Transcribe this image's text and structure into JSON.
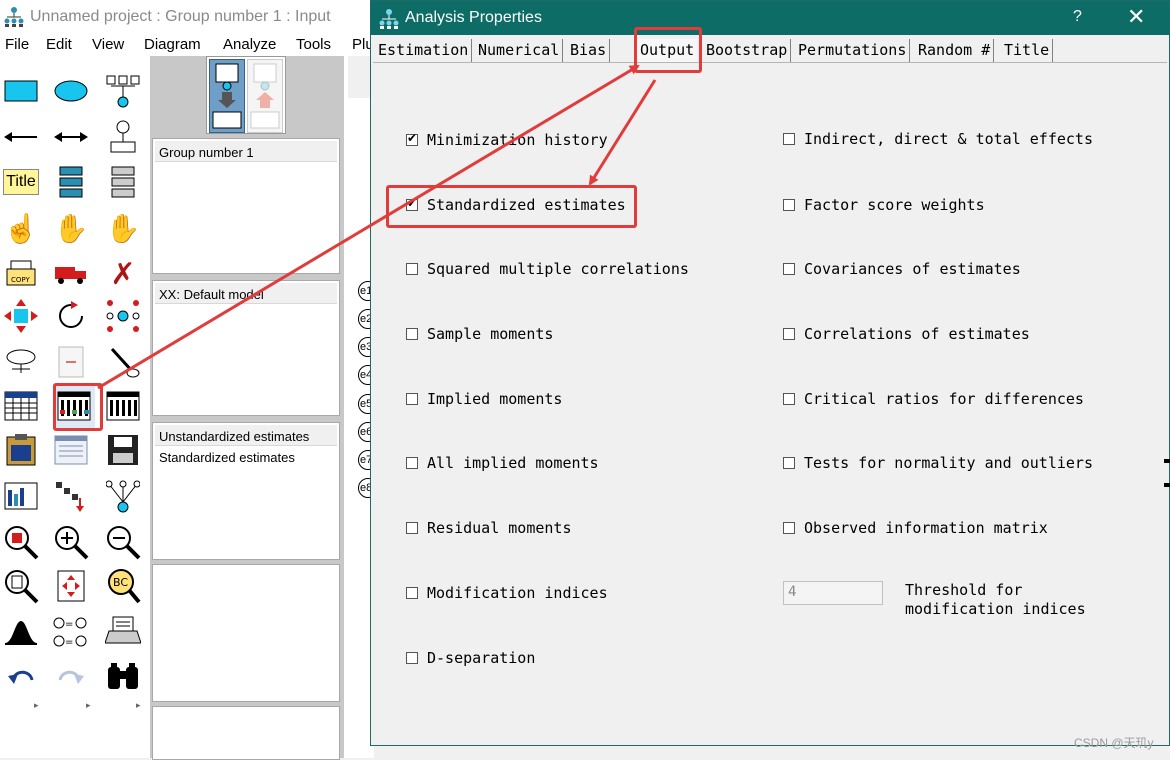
{
  "main_window": {
    "title": "Unnamed project : Group number 1 : Input"
  },
  "menu": [
    "File",
    "Edit",
    "View",
    "Diagram",
    "Analyze",
    "Tools",
    "Plu"
  ],
  "panels": {
    "groups": [
      "Group number 1"
    ],
    "models": [
      "XX: Default model"
    ],
    "estimates": [
      "Unstandardized estimates",
      "Standardized estimates"
    ]
  },
  "path_labels": [
    "e1",
    "e2",
    "e3",
    "e4",
    "e5",
    "e6",
    "e7",
    "e8"
  ],
  "toolbox": {
    "title_tool_label": "Title"
  },
  "dialog": {
    "title": "Analysis Properties",
    "help": "?",
    "close": "✕",
    "tabs": [
      "Estimation",
      "Numerical",
      "Bias",
      "Output",
      "Bootstrap",
      "Permutations",
      "Random #",
      "Title"
    ],
    "active_tab": "Output",
    "options_left": [
      {
        "label": "Minimization history",
        "checked": true
      },
      {
        "label": "Standardized estimates",
        "checked": true
      },
      {
        "label": "Squared multiple correlations",
        "checked": false
      },
      {
        "label": "Sample moments",
        "checked": false
      },
      {
        "label": "Implied moments",
        "checked": false
      },
      {
        "label": "All implied moments",
        "checked": false
      },
      {
        "label": "Residual moments",
        "checked": false
      },
      {
        "label": "Modification indices",
        "checked": false
      },
      {
        "label": "D-separation",
        "checked": false
      }
    ],
    "options_right": [
      {
        "label": "Indirect, direct & total effects",
        "checked": false
      },
      {
        "label": "Factor score weights",
        "checked": false
      },
      {
        "label": "Covariances of estimates",
        "checked": false
      },
      {
        "label": "Correlations of estimates",
        "checked": false
      },
      {
        "label": "Critical ratios for differences",
        "checked": false
      },
      {
        "label": "Tests for normality and outliers",
        "checked": false
      },
      {
        "label": "Observed information matrix",
        "checked": false
      }
    ],
    "threshold": {
      "value": "4",
      "label_line1": "Threshold for",
      "label_line2": "modification indices"
    }
  },
  "watermark": "CSDN @天玑y",
  "colors": {
    "dialog_title_bg": "#0d6d66",
    "annotation": "#e03c3c"
  }
}
